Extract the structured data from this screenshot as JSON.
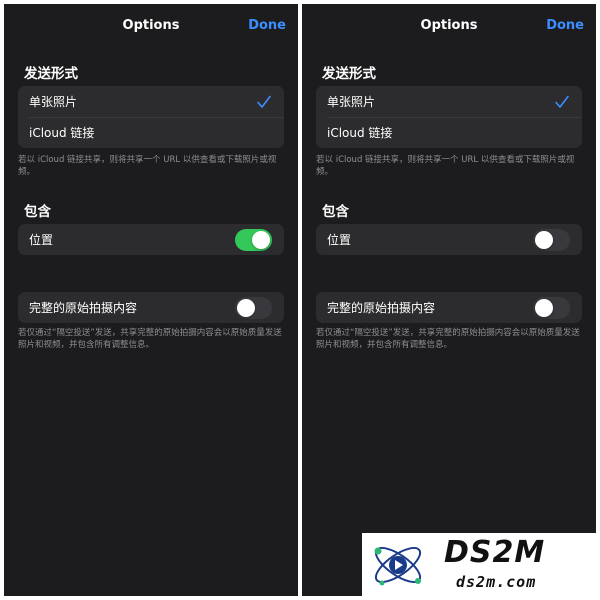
{
  "screens": [
    {
      "nav": {
        "title": "Options",
        "done_label": "Done"
      },
      "send_as": {
        "header": "发送形式",
        "options": [
          {
            "label": "单张照片",
            "selected": true
          },
          {
            "label": "iCloud 链接",
            "selected": false
          }
        ],
        "footer": "若以 iCloud 链接共享，则将共享一个 URL 以供查看或下载照片或视频。"
      },
      "include": {
        "header": "包含",
        "location_label": "位置",
        "location_on": true
      },
      "all_photos_data": {
        "label": "完整的原始拍摄内容",
        "on": false,
        "footer": "若仅通过“隔空投送”发送，共享完整的原始拍摄内容会以原始质量发送照片和视频，并包含所有调整信息。"
      }
    },
    {
      "nav": {
        "title": "Options",
        "done_label": "Done"
      },
      "send_as": {
        "header": "发送形式",
        "options": [
          {
            "label": "单张照片",
            "selected": true
          },
          {
            "label": "iCloud 链接",
            "selected": false
          }
        ],
        "footer": "若以 iCloud 链接共享，则将共享一个 URL 以供查看或下载照片或视频。"
      },
      "include": {
        "header": "包含",
        "location_label": "位置",
        "location_on": false
      },
      "all_photos_data": {
        "label": "完整的原始拍摄内容",
        "on": false,
        "footer": "若仅通过“隔空投送”发送，共享完整的原始拍摄内容会以原始质量发送照片和视频，并包含所有调整信息。"
      }
    }
  ],
  "watermark": {
    "brand": "DS2M",
    "url": "ds2m.com"
  },
  "colors": {
    "background": "#1c1c1e",
    "group": "#2c2c2e",
    "accent": "#3a8eff",
    "toggle_on": "#34c759",
    "toggle_off": "#39393d",
    "footer_text": "#8e8e93"
  }
}
